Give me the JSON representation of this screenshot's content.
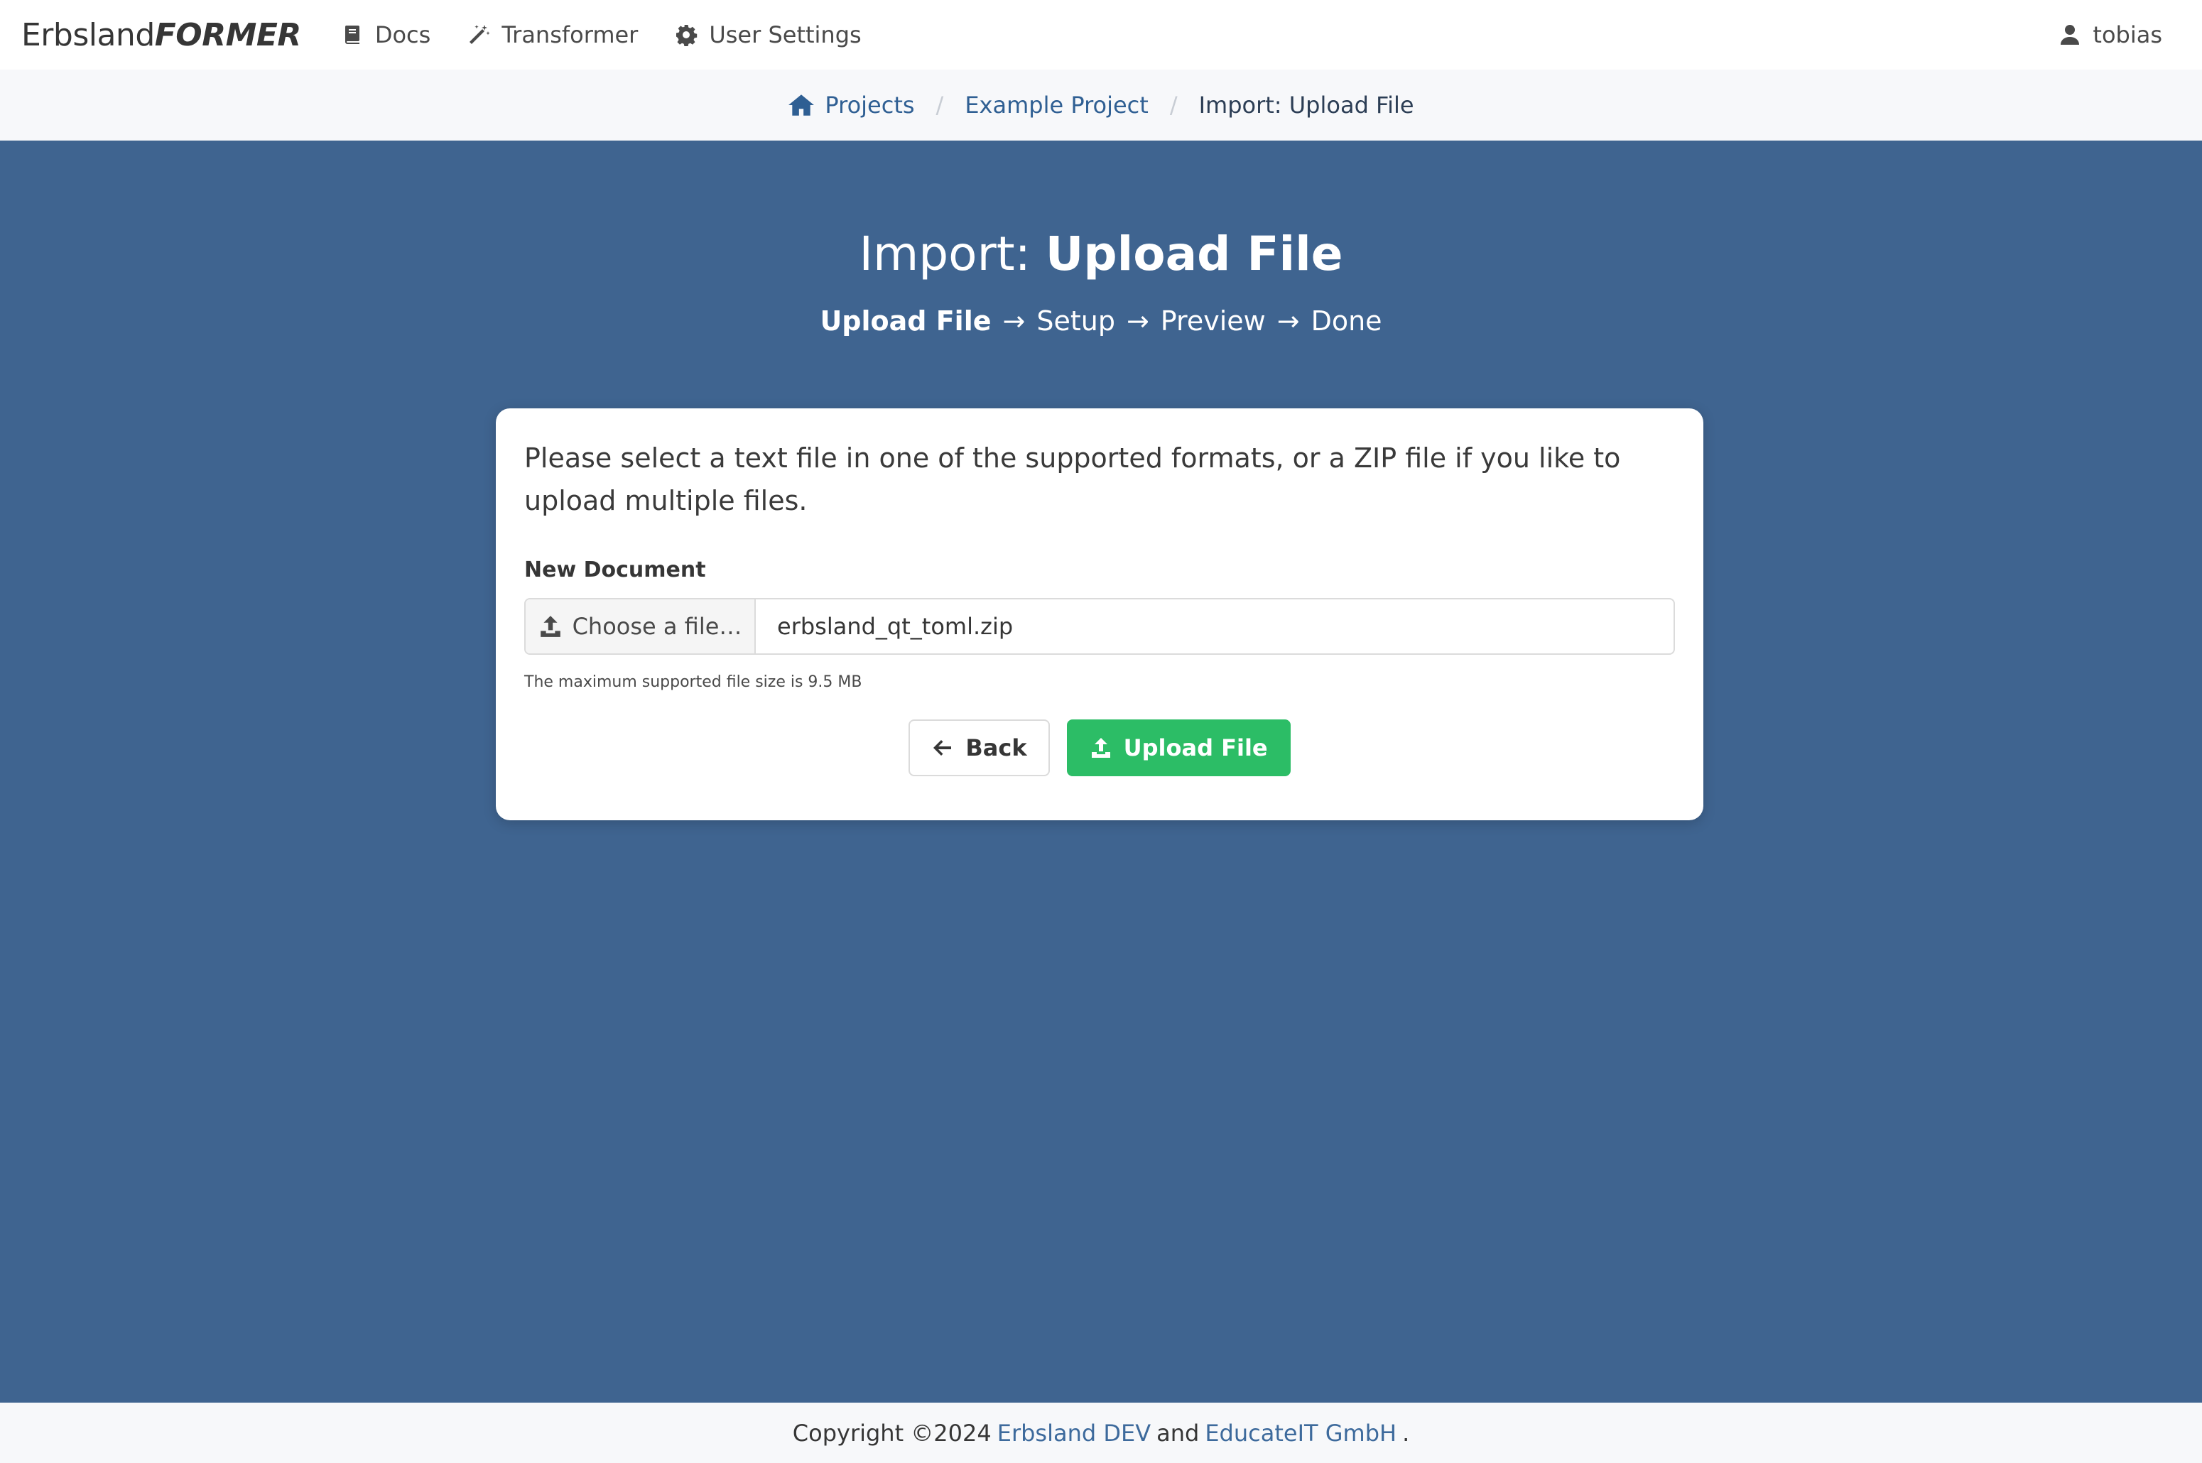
{
  "navbar": {
    "brand_part1": "Erbsland",
    "brand_part2": "FORMER",
    "items": [
      {
        "label": "Docs",
        "icon": "book-icon"
      },
      {
        "label": "Transformer",
        "icon": "magic-wand-icon"
      },
      {
        "label": "User Settings",
        "icon": "gear-icon"
      }
    ],
    "user": {
      "label": "tobias",
      "icon": "user-icon"
    }
  },
  "breadcrumb": {
    "items": [
      {
        "label": "Projects",
        "icon": "home-icon"
      },
      {
        "label": "Example Project"
      },
      {
        "label": "Import: Upload File"
      }
    ],
    "separator": "/"
  },
  "page": {
    "title_prefix": "Import:",
    "title_strong": "Upload File",
    "steps": [
      "Upload File",
      "Setup",
      "Preview",
      "Done"
    ],
    "step_arrow": "→"
  },
  "card": {
    "intro": "Please select a text file in one of the supported formats, or a ZIP file if you like to upload multiple files.",
    "field_label": "New Document",
    "file_button_label": "Choose a file…",
    "file_name": "erbsland_qt_toml.zip",
    "help_text": "The maximum supported file size is 9.5 MB",
    "back_label": "Back",
    "upload_label": "Upload File"
  },
  "footer": {
    "prefix": "Copyright ©2024",
    "link1": "Erbsland DEV",
    "middle": "and",
    "link2": "EducateIT GmbH",
    "suffix": "."
  },
  "colors": {
    "background": "#3f6490",
    "link": "#2f5f93",
    "upload_button": "#2cbd66"
  }
}
